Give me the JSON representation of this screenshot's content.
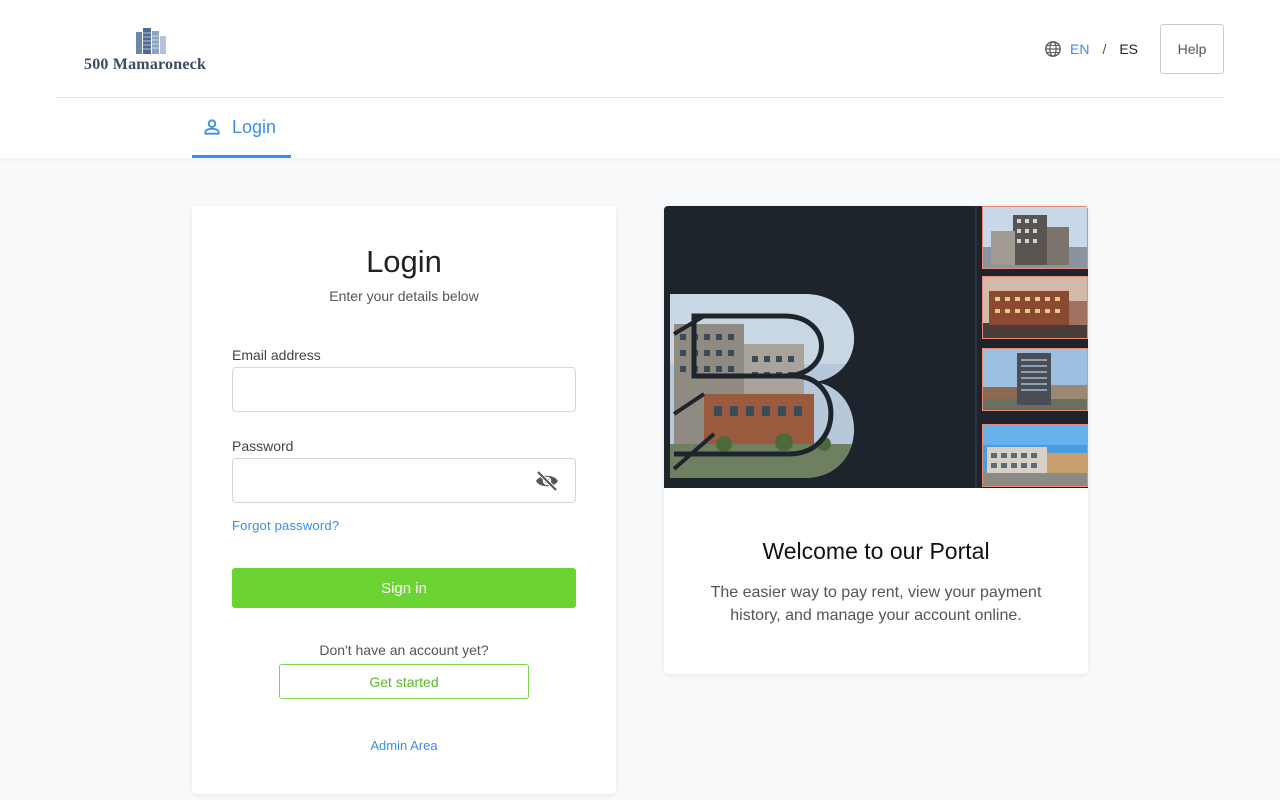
{
  "header": {
    "logo_text": "500 Mamaroneck",
    "lang_en": "EN",
    "lang_sep": "/",
    "lang_es": "ES",
    "help_label": "Help"
  },
  "tabs": [
    {
      "label": "Login",
      "icon": "person-icon",
      "active": true
    }
  ],
  "login": {
    "title": "Login",
    "subtitle": "Enter your details below",
    "email_label": "Email address",
    "email_value": "",
    "password_label": "Password",
    "password_value": "",
    "forgot_label": "Forgot password?",
    "signin_label": "Sign in",
    "no_account_text": "Don't have an account yet?",
    "get_started_label": "Get started",
    "admin_label": "Admin Area"
  },
  "welcome": {
    "title": "Welcome to our Portal",
    "text": "The easier way to pay rent, view your payment history, and manage your account online."
  },
  "colors": {
    "accent": "#3b8ee8",
    "primary_button": "#6cd334",
    "hero_bg": "#1e242c"
  }
}
